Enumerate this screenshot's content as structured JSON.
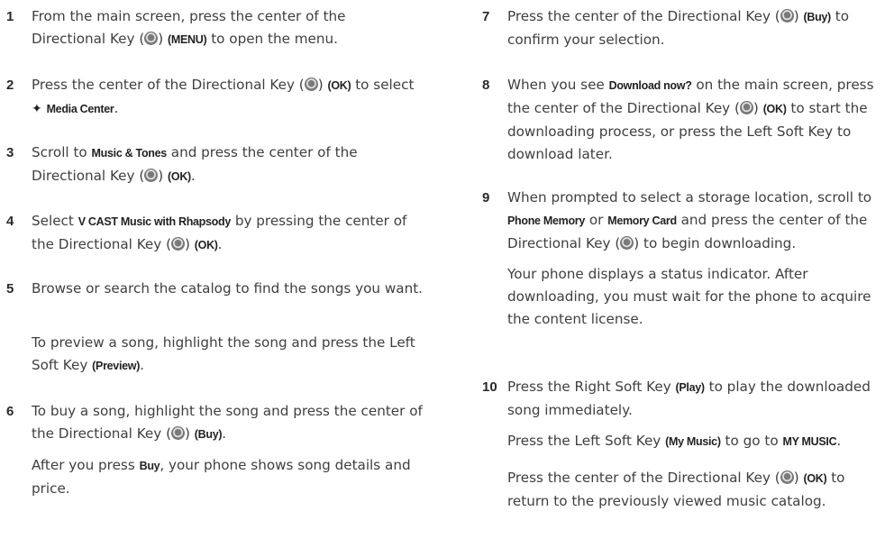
{
  "icons": {
    "directional_key": "directional-key-icon",
    "media_center": "media-center-icon"
  },
  "left": [
    {
      "num": "1",
      "parts": [
        "From the main screen, press the center of the Directional Key (",
        {
          "icon": "nav"
        },
        ") ",
        {
          "k": "(MENU)"
        },
        " to open the menu."
      ]
    },
    {
      "num": "2",
      "parts": [
        "Press the center of the Directional Key (",
        {
          "icon": "nav"
        },
        ") ",
        {
          "k": "(OK)"
        },
        " to select ",
        {
          "icon": "media"
        },
        " ",
        {
          "k": "Media Center"
        },
        "."
      ]
    },
    {
      "num": "3",
      "parts": [
        "Scroll to ",
        {
          "k": "Music & Tones"
        },
        " and press the center of the Directional Key (",
        {
          "icon": "nav"
        },
        ") ",
        {
          "k": "(OK)"
        },
        "."
      ]
    },
    {
      "num": "4",
      "parts": [
        "Select ",
        {
          "k": "V CAST Music with Rhapsody"
        },
        " by pressing the center of the Directional Key (",
        {
          "icon": "nav"
        },
        ") ",
        {
          "k": "(OK)"
        },
        "."
      ]
    },
    {
      "num": "5",
      "parts": [
        "Browse or search the catalog to find the songs you want."
      ],
      "note": [
        "To preview a song, highlight the song and press the Left Soft Key ",
        {
          "k": "(Preview)"
        },
        "."
      ]
    },
    {
      "num": "6",
      "parts": [
        "To buy a song, highlight the song and press the center of the Directional Key (",
        {
          "icon": "nav"
        },
        ") ",
        {
          "k": "(Buy)"
        },
        "."
      ],
      "note": [
        "After you press ",
        {
          "k": "Buy"
        },
        ", your phone shows song details and price."
      ]
    }
  ],
  "right": [
    {
      "num": "7",
      "parts": [
        "Press the center of the Directional Key (",
        {
          "icon": "nav"
        },
        ") ",
        {
          "k": "(Buy)"
        },
        " to confirm your selection."
      ]
    },
    {
      "num": "8",
      "parts": [
        "When you see ",
        {
          "k": "Download now?"
        },
        " on the main screen, press the center of the Directional Key (",
        {
          "icon": "nav"
        },
        ") ",
        {
          "k": "(OK)"
        },
        " to start the downloading process, or press the Left Soft Key to download later."
      ]
    },
    {
      "num": "9",
      "parts": [
        "When prompted to select a storage location, scroll to ",
        {
          "k": "Phone Memory"
        },
        " or ",
        {
          "k": "Memory Card"
        },
        " and press the center of the Directional Key (",
        {
          "icon": "nav"
        },
        ") to begin downloading."
      ],
      "note": [
        "Your phone displays a status indicator. After downloading, you must wait for the phone to acquire the content license."
      ]
    },
    {
      "num": "10",
      "parts": [
        "Press the Right Soft Key ",
        {
          "k": "(Play)"
        },
        " to play the downloaded song immediately."
      ],
      "notes": [
        [
          "Press the Left Soft Key ",
          {
            "k": "(My Music)"
          },
          " to go to ",
          {
            "k": "MY MUSIC"
          },
          "."
        ],
        [
          "Press the center of the Directional Key (",
          {
            "icon": "nav"
          },
          ") ",
          {
            "k": "(OK)"
          },
          " to return to the previously viewed music catalog."
        ]
      ]
    }
  ]
}
